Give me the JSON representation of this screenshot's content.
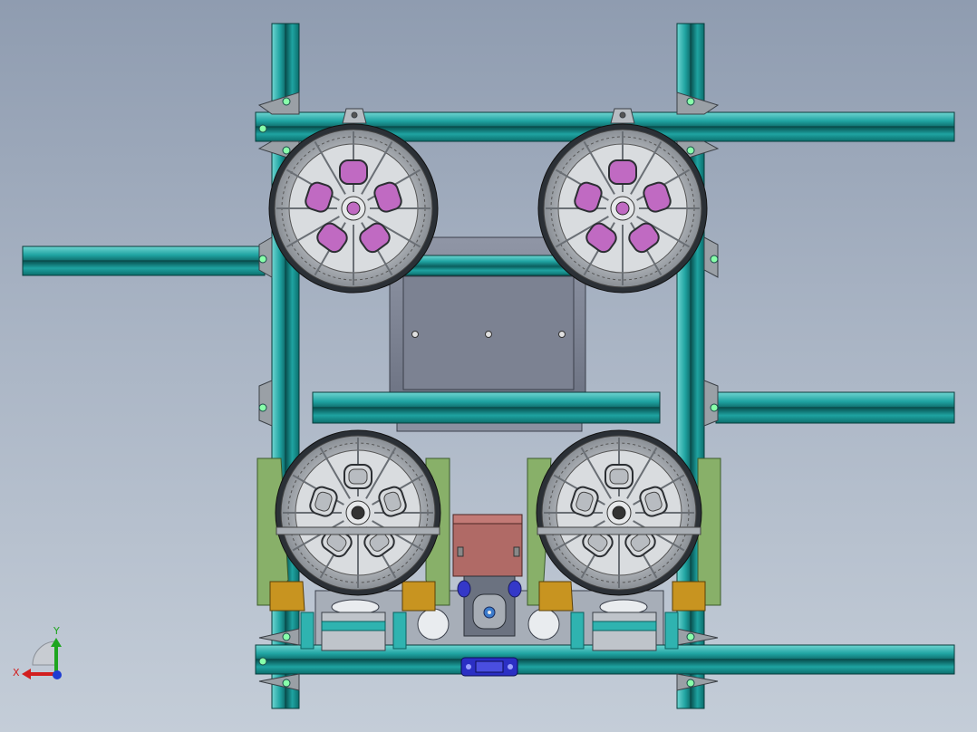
{
  "viewport": {
    "background_top": "#8f9cb0",
    "background_bottom": "#c4cdd8"
  },
  "colors": {
    "extrusion": "#1fa3a1",
    "extrusion_dark": "#0b5f5e",
    "extrusion_light": "#6fd6d2",
    "bracket": "#9aa0a6",
    "wheel_rim": "#c9ccd0",
    "wheel_tire": "#2b3036",
    "hub_pink": "#c06ac2",
    "battery_plate": "#7f8596",
    "motor_mount": "#88b069",
    "mount_ochre": "#c89420",
    "controller_red": "#b06a66",
    "coupler_blue": "#2b2fc4"
  },
  "triad": {
    "x_label": "X",
    "y_label": "Y",
    "x_color": "#d21e1e",
    "y_color": "#1ea51e",
    "z_color": "#1e3cd2"
  },
  "icons": [
    "coordinate-triad-icon"
  ]
}
